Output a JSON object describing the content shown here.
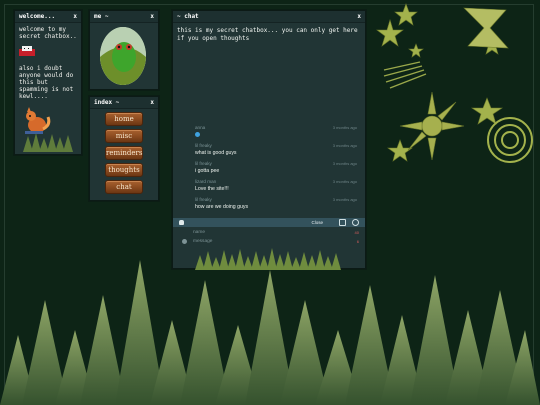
{
  "welcome": {
    "title": "welcome...",
    "close": "x",
    "intro": "welcome to my secret chatbox..",
    "note": "also i doubt anyone would do this but spamming is not kewl...."
  },
  "me": {
    "title": "me ~",
    "close": "x"
  },
  "index": {
    "title": "index ~",
    "close": "x",
    "items": [
      "home",
      "misc",
      "reminders",
      "thoughts",
      "chat"
    ]
  },
  "chat": {
    "title": "~ chat",
    "close": "x",
    "intro": "this is my secret chatbox... you can only get here if you open thoughts",
    "messages": [
      {
        "name": "anna",
        "time": "3 months ago",
        "text": ""
      },
      {
        "name": "lil freaky",
        "time": "3 months ago",
        "text": "what is good guys"
      },
      {
        "name": "lil freaky",
        "time": "3 months ago",
        "text": "i gotta pee"
      },
      {
        "name": "lizard man",
        "time": "3 months ago",
        "text": "Love the site!!!"
      },
      {
        "name": "lil freaky",
        "time": "3 months ago",
        "text": "how are we doing guys"
      }
    ],
    "toolbar": {
      "close": "Close"
    },
    "name_placeholder": "name",
    "message_placeholder": "message",
    "name_count": "40",
    "message_count": "6"
  },
  "colors": {
    "background": "#0d2416",
    "window": "#213535",
    "toolbar": "#33525c",
    "deco": "#a3b24c"
  }
}
